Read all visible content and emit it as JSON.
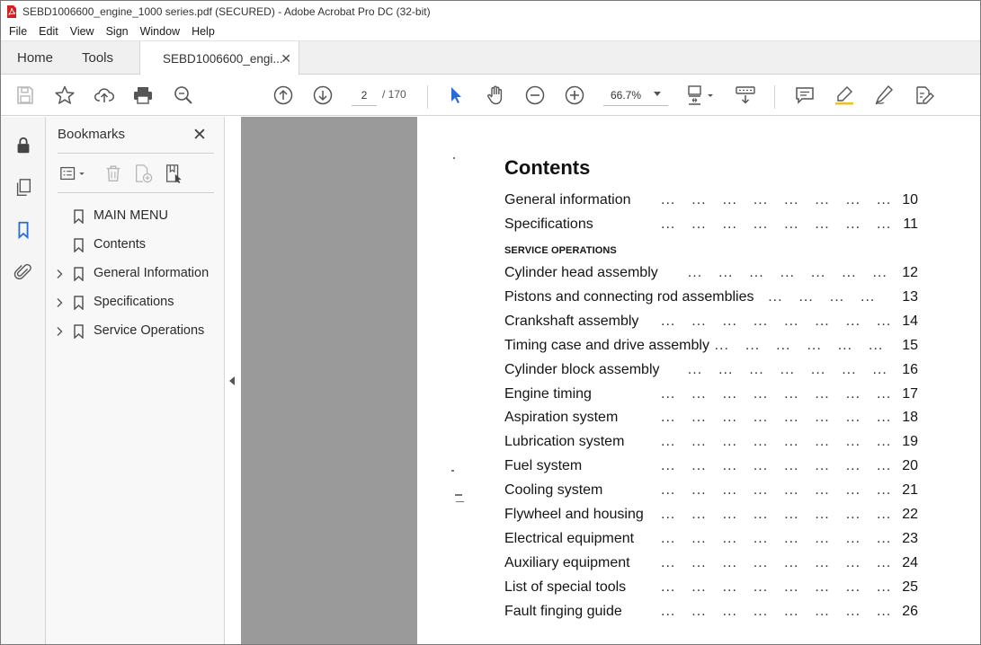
{
  "window": {
    "title": "SEBD1006600_engine_1000 series.pdf (SECURED) - Adobe Acrobat Pro DC (32-bit)"
  },
  "menu": [
    "File",
    "Edit",
    "View",
    "Sign",
    "Window",
    "Help"
  ],
  "tabs": {
    "home": "Home",
    "tools": "Tools",
    "document": "SEBD1006600_engi..."
  },
  "toolbar": {
    "current_page": "2",
    "total_pages": "/ 170",
    "zoom": "66.7%"
  },
  "bookmarks": {
    "title": "Bookmarks",
    "items": [
      {
        "label": "MAIN MENU",
        "expandable": false
      },
      {
        "label": "Contents",
        "expandable": false
      },
      {
        "label": "General Information",
        "expandable": true
      },
      {
        "label": "Specifications",
        "expandable": true
      },
      {
        "label": "Service Operations",
        "expandable": true
      }
    ]
  },
  "document": {
    "heading": "Contents",
    "section_label": "SERVICE OPERATIONS",
    "entries_top": [
      {
        "title": "General information",
        "page": "10"
      },
      {
        "title": "Specifications",
        "page": "11"
      }
    ],
    "entries_service": [
      {
        "title": "Cylinder head assembly",
        "page": "12"
      },
      {
        "title": "Pistons and connecting rod assemblies",
        "page": "13"
      },
      {
        "title": "Crankshaft assembly",
        "page": "14"
      },
      {
        "title": "Timing case and drive assembly",
        "page": "15"
      },
      {
        "title": "Cylinder block assembly",
        "page": "16"
      },
      {
        "title": "Engine timing",
        "page": "17"
      },
      {
        "title": "Aspiration system",
        "page": "18"
      },
      {
        "title": "Lubrication system",
        "page": "19"
      },
      {
        "title": "Fuel system",
        "page": "20"
      },
      {
        "title": "Cooling system",
        "page": "21"
      },
      {
        "title": "Flywheel and housing",
        "page": "22"
      },
      {
        "title": "Electrical equipment",
        "page": "23"
      },
      {
        "title": "Auxiliary equipment",
        "page": "24"
      },
      {
        "title": "List of special tools",
        "page": "25"
      },
      {
        "title": "Fault finging guide",
        "page": "26"
      }
    ]
  },
  "colors": {
    "accent_blue": "#2b6cd4",
    "pdf_red": "#d42020",
    "gray_gap": "#9a9a9a"
  }
}
